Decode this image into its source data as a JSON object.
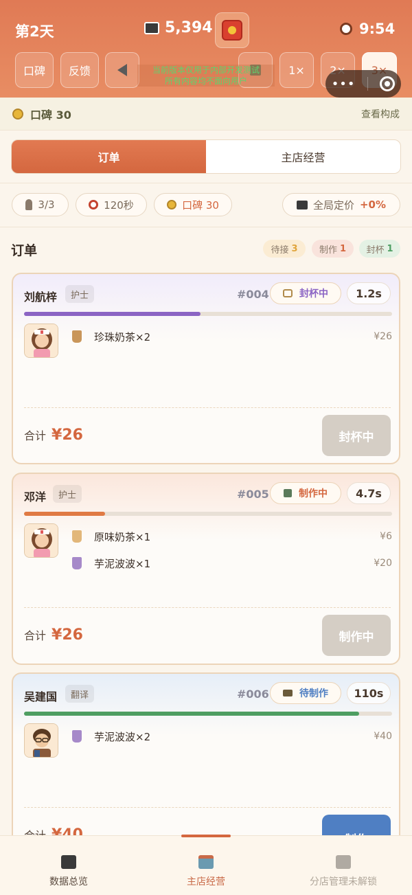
{
  "header": {
    "day": "第2天",
    "coins": "5,394",
    "clock": "9:54",
    "buttons": {
      "reputation": "口碑",
      "feedback": "反馈",
      "speed_1x": "1×",
      "speed_2x": "2×",
      "speed_3x": "3×"
    },
    "notice_line1": "当前版本仅用于内部开发测试",
    "notice_line2": "所有内容均不面向用户"
  },
  "reputation_bar": {
    "label": "口碑 30",
    "link": "查看构成"
  },
  "tabs": [
    {
      "label": "订单",
      "active": true
    },
    {
      "label": "主店经营",
      "active": false
    }
  ],
  "stats": {
    "staff": "3/3",
    "duration": "120秒",
    "reputation": "口碑 30",
    "pricing_label": "全局定价",
    "pricing_value": "+0%"
  },
  "orders_section": {
    "title": "订单",
    "badges": {
      "pending_label": "待接",
      "pending_count": "3",
      "making_label": "制作",
      "making_count": "1",
      "sealing_label": "封杯",
      "sealing_count": "1"
    }
  },
  "orders": [
    {
      "customer": "刘航梓",
      "role": "护士",
      "number": "#004",
      "status": "封杯中",
      "timer": "1.2s",
      "progress": 0.48,
      "items": [
        {
          "name": "珍珠奶茶×2",
          "price": "¥26"
        }
      ],
      "total_label": "合计",
      "total": "¥26",
      "action": "封杯中"
    },
    {
      "customer": "邓洋",
      "role": "护士",
      "number": "#005",
      "status": "制作中",
      "timer": "4.7s",
      "progress": 0.22,
      "items": [
        {
          "name": "原味奶茶×1",
          "price": "¥6"
        },
        {
          "name": "芋泥波波×1",
          "price": "¥20"
        }
      ],
      "total_label": "合计",
      "total": "¥26",
      "action": "制作中"
    },
    {
      "customer": "吴建国",
      "role": "翻译",
      "number": "#006",
      "status": "待制作",
      "timer": "110s",
      "progress": 0.91,
      "items": [
        {
          "name": "芋泥波波×2",
          "price": "¥40"
        }
      ],
      "total_label": "合计",
      "total": "¥40",
      "action": "制作"
    }
  ],
  "bottom_nav": [
    {
      "label": "数据总览",
      "active": false
    },
    {
      "label": "主店经营",
      "active": true
    },
    {
      "label": "分店管理未解锁",
      "active": false
    }
  ],
  "colors": {
    "accent": "#d4673f",
    "header": "#e07a55",
    "progress_sealing": "#8b64c4",
    "progress_making": "#e07a44",
    "progress_pending": "#4e9e62",
    "make_button": "#4f7fc3"
  }
}
